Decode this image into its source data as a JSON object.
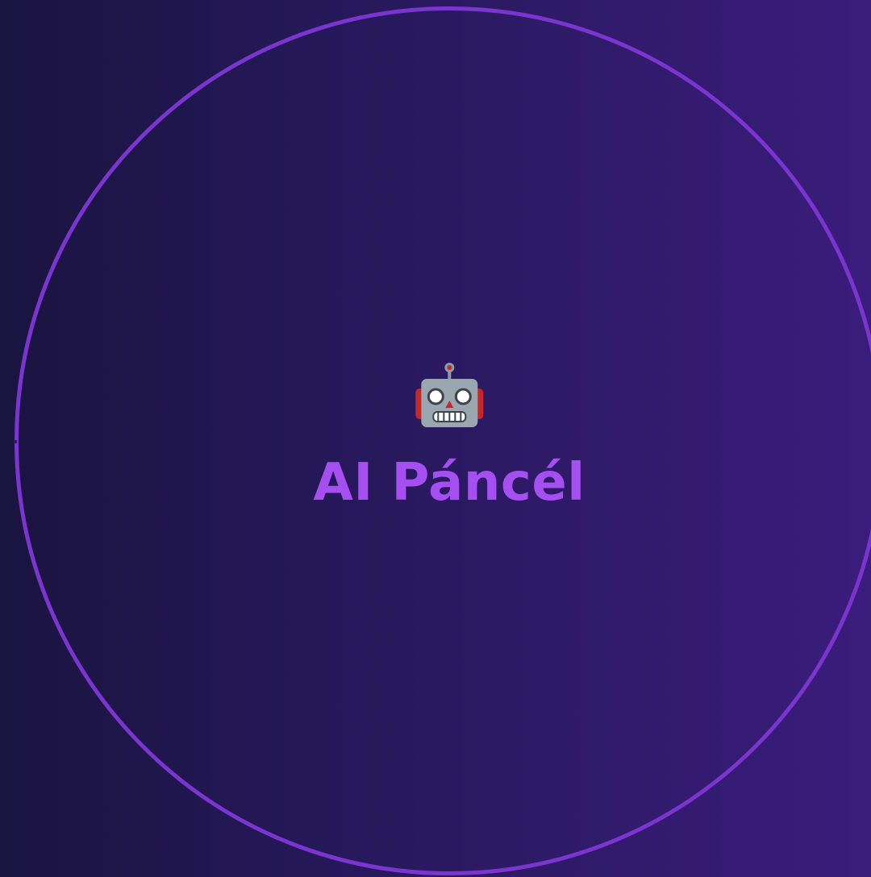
{
  "app": {
    "icon": "robot-icon",
    "title": "AI Páncél"
  },
  "theme": {
    "background_gradient": [
      "#1a1440",
      "#241858",
      "#2f1a68",
      "#3a1c7c"
    ],
    "ring_color": "#7b35cf",
    "title_color": "#a54ff0"
  }
}
